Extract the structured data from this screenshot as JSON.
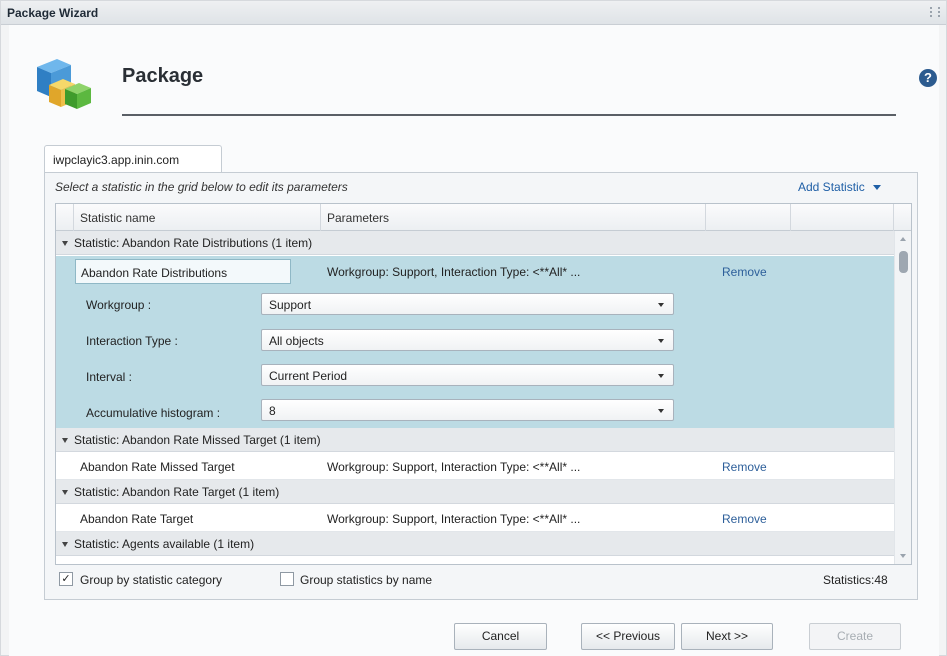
{
  "window": {
    "title": "Package Wizard"
  },
  "header": {
    "title": "Package",
    "help": "?"
  },
  "tab": {
    "label": "iwpclayic3.app.inin.com"
  },
  "instructions": "Select a statistic in the grid below to edit its parameters",
  "add_statistic": "Add Statistic",
  "grid": {
    "columns": [
      "Statistic name",
      "Parameters"
    ],
    "groups": [
      {
        "label": "Statistic: Abandon Rate Distributions (1 item)",
        "row": {
          "name": "Abandon Rate Distributions",
          "params": "Workgroup: Support, Interaction Type: <**All* ...",
          "action": "Remove"
        },
        "fields": [
          {
            "label": "Workgroup :",
            "value": "Support"
          },
          {
            "label": "Interaction Type :",
            "value": "All objects"
          },
          {
            "label": "Interval :",
            "value": "Current Period"
          },
          {
            "label": "Accumulative histogram :",
            "value": "8"
          }
        ]
      },
      {
        "label": "Statistic: Abandon Rate Missed Target (1 item)",
        "row": {
          "name": "Abandon Rate Missed Target",
          "params": "Workgroup: Support, Interaction Type: <**All* ...",
          "action": "Remove"
        }
      },
      {
        "label": "Statistic: Abandon Rate Target (1 item)",
        "row": {
          "name": "Abandon Rate Target",
          "params": "Workgroup: Support, Interaction Type: <**All* ...",
          "action": "Remove"
        }
      },
      {
        "label": "Statistic: Agents available (1 item)"
      }
    ]
  },
  "options": {
    "group_by_category": {
      "label": "Group by statistic category",
      "checked": true,
      "mark": "✓"
    },
    "group_by_name": {
      "label": "Group statistics by name",
      "checked": false
    }
  },
  "statistics_count": "Statistics:48",
  "buttons": {
    "cancel": "Cancel",
    "previous": "<< Previous",
    "next": "Next >>",
    "create": "Create"
  },
  "colors": {
    "selected_row": "#bcdbe4",
    "link": "#1f5fa6"
  },
  "icons": {
    "package": "package-cubes-icon",
    "help": "help-icon"
  }
}
